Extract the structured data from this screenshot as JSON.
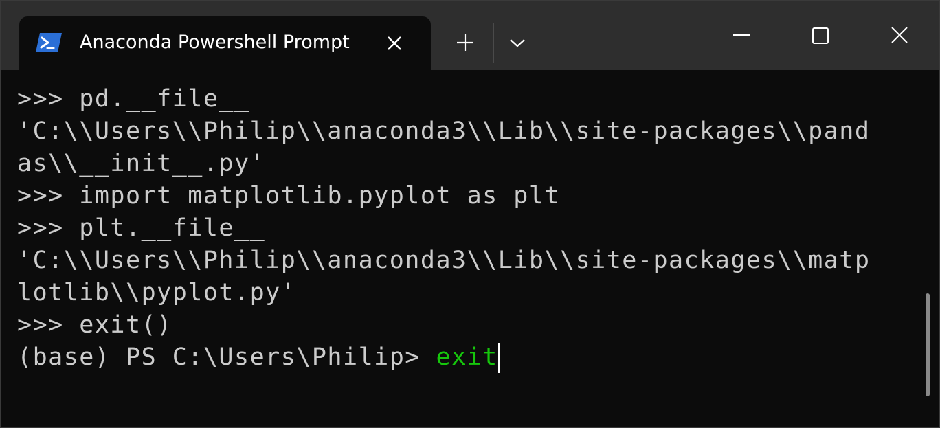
{
  "window": {
    "tab": {
      "title": "Anaconda Powershell Prompt",
      "icon": "powershell-icon"
    },
    "controls": {
      "new_tab_icon": "plus-icon",
      "dropdown_icon": "chevron-down-icon",
      "minimize_icon": "minimize-icon",
      "maximize_icon": "maximize-icon",
      "close_icon": "close-icon"
    }
  },
  "terminal": {
    "lines": [
      ">>> pd.__file__",
      "'C:\\\\Users\\\\Philip\\\\anaconda3\\\\Lib\\\\site-packages\\\\pand",
      "as\\\\__init__.py'",
      ">>> import matplotlib.pyplot as plt",
      ">>> plt.__file__",
      "'C:\\\\Users\\\\Philip\\\\anaconda3\\\\Lib\\\\site-packages\\\\matp",
      "lotlib\\\\pyplot.py'",
      ">>> exit()"
    ],
    "prompt": "(base) PS C:\\Users\\Philip> ",
    "current_input": "exit"
  },
  "colors": {
    "background": "#0c0c0c",
    "titlebar": "#2e2e2e",
    "text": "#cccccc",
    "command_green": "#16c60c",
    "powershell_blue": "#2b6fd6"
  }
}
